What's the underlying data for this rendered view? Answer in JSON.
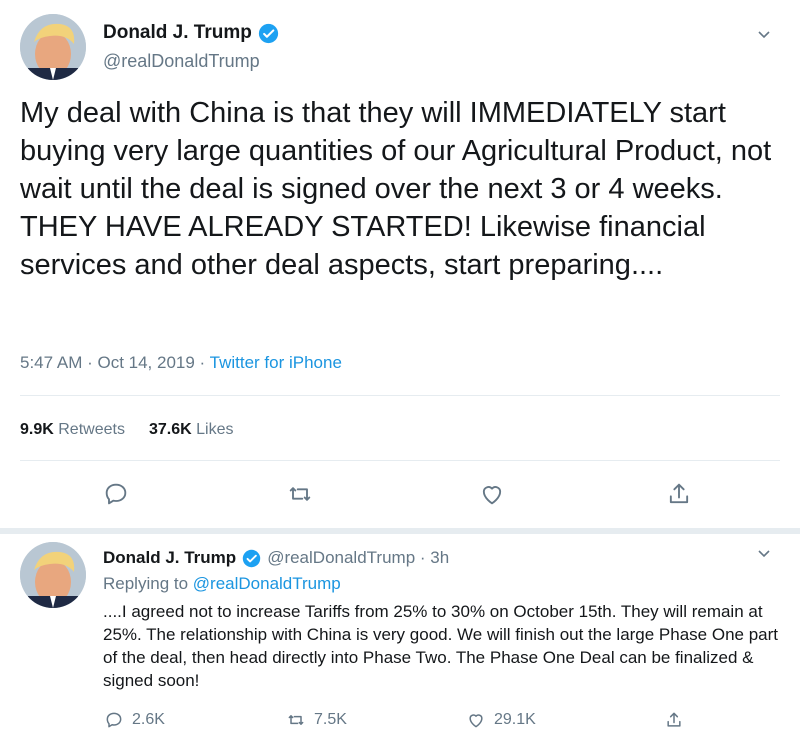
{
  "colors": {
    "text": "#14171a",
    "secondary": "#657786",
    "link": "#1b95e0",
    "verified": "#1da1f2",
    "border": "#e6ecf0"
  },
  "main_tweet": {
    "author_name": "Donald J. Trump",
    "author_handle": "@realDonaldTrump",
    "text": "My deal with China is that they will IMMEDIATELY start buying very large quantities of our Agricultural Product, not wait until the deal is signed over the next 3 or 4 weeks. THEY HAVE ALREADY STARTED! Likewise financial services and other deal aspects, start preparing....",
    "timestamp": "5:47 AM · Oct 14, 2019 · ",
    "source": "Twitter for iPhone",
    "retweets_count": "9.9K",
    "retweets_label": "Retweets",
    "likes_count": "37.6K",
    "likes_label": "Likes",
    "icons": [
      "reply-icon",
      "retweet-icon",
      "like-icon",
      "share-icon",
      "chevron-down-icon",
      "verified-icon"
    ]
  },
  "reply_tweet": {
    "author_name": "Donald J. Trump",
    "author_handle": "@realDonaldTrump · 3h",
    "replying_prefix": "Replying to ",
    "replying_to": "@realDonaldTrump",
    "text": "....I agreed not to increase Tariffs from 25% to 30% on October 15th. They will remain at 25%. The relationship with China is very good. We will finish out the large Phase One part of the deal, then head directly into Phase Two. The Phase One Deal can be finalized & signed soon!",
    "reply_count": "2.6K",
    "retweet_count": "7.5K",
    "like_count": "29.1K"
  }
}
